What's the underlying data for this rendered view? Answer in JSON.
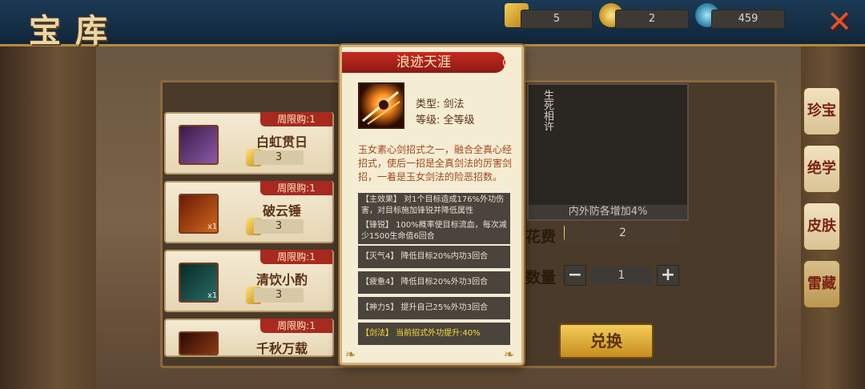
{
  "header": {
    "title": "宝库",
    "resources": [
      {
        "icon": "ticket-icon",
        "value": "5"
      },
      {
        "icon": "coin-icon",
        "value": "2"
      },
      {
        "icon": "gem-icon",
        "value": "459"
      }
    ],
    "close_icon": "close-icon"
  },
  "shop_items": [
    {
      "ribbon": "周限购:1",
      "name": "白虹贯日",
      "price": "3",
      "count": ""
    },
    {
      "ribbon": "周限购:1",
      "name": "破云锤",
      "price": "3",
      "count": "x1"
    },
    {
      "ribbon": "周限购:1",
      "name": "清饮小酌",
      "price": "3",
      "count": "x1"
    },
    {
      "ribbon": "周限购:1",
      "name": "千秋万载",
      "price": "",
      "count": ""
    }
  ],
  "preview": {
    "title": "生死相许",
    "effect": "内外防各增加4%"
  },
  "purchase": {
    "cost_label": "花费",
    "cost_value": "2",
    "amount_label": "数量",
    "minus": "−",
    "plus": "+",
    "amount_value": "1",
    "redeem_label": "兑换"
  },
  "side_tabs": [
    {
      "label": "珍宝"
    },
    {
      "label": "绝学"
    },
    {
      "label": "皮肤"
    },
    {
      "label": "雷藏"
    }
  ],
  "popup": {
    "title": "浪迹天涯",
    "type": "类型: 剑法",
    "level": "等级: 全等级",
    "description": "玉女素心剑招式之一，融合全真心经招式，使后一招是全真剑法的厉害剑招，一着是玉女剑法的险恶招数。",
    "effects": [
      {
        "text": "【主效果】 对1个目标造成176%外功伤害，对目标施加锋锐并降低属性"
      },
      {
        "text": "【锋锐】 100%概率使目标流血，每次减少1500生命值6回合"
      },
      {
        "text": "【灭气4】 降低目标20%内功3回合"
      },
      {
        "text": "【疲惫4】 降低目标20%外功3回合"
      },
      {
        "text": "【神力5】 提升自己25%外功3回合"
      },
      {
        "text": "【剑法】 当前招式外功提升:40%"
      }
    ]
  },
  "colors": {
    "accent_red": "#c42a20",
    "gold": "#f3cc5a",
    "panel_dark": "#4b443c",
    "highlight_yellow": "#f7df34"
  }
}
